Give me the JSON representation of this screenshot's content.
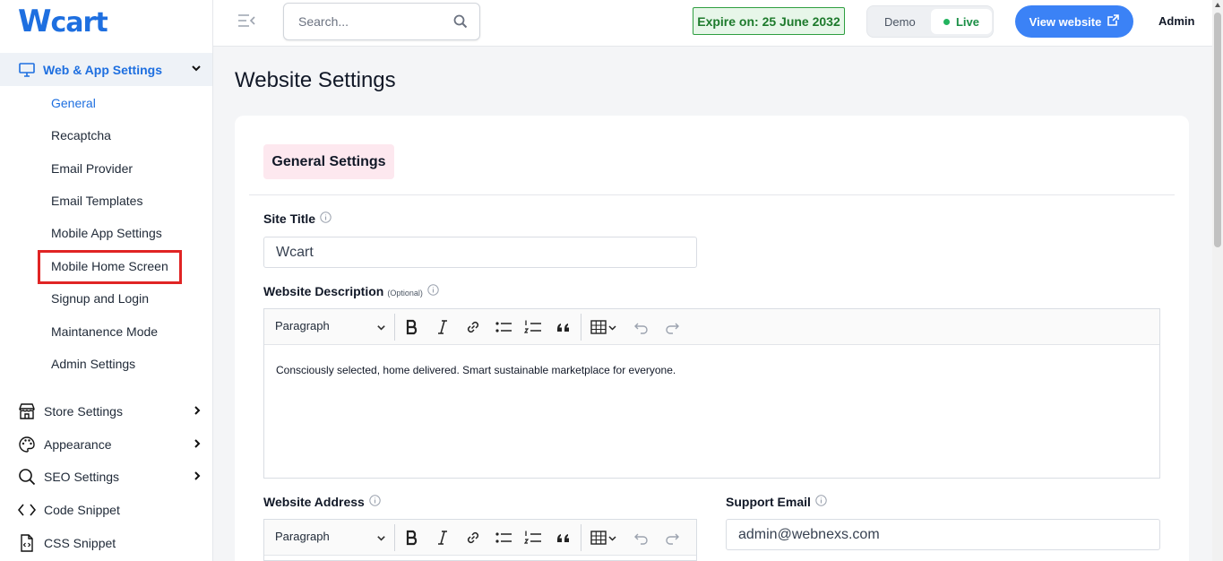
{
  "logo": {
    "text_w": "W",
    "text_rest": "cart"
  },
  "sidebar": {
    "active_section": "Web & App Settings",
    "sub_items": [
      "General",
      "Recaptcha",
      "Email Provider",
      "Email Templates",
      "Mobile App Settings",
      "Mobile Home Screen",
      "Signup and Login",
      "Maintanence Mode",
      "Admin Settings"
    ],
    "items": [
      {
        "label": "Store Settings",
        "icon": "store-icon"
      },
      {
        "label": "Appearance",
        "icon": "palette-icon"
      },
      {
        "label": "SEO Settings",
        "icon": "search-icon"
      },
      {
        "label": "Code Snippet",
        "icon": "code-icon"
      },
      {
        "label": "CSS Snippet",
        "icon": "file-code-icon"
      }
    ]
  },
  "topbar": {
    "search_placeholder": "Search...",
    "expire": "Expire on: 25 June 2032",
    "mode_demo": "Demo",
    "mode_live": "Live",
    "view_website": "View website",
    "admin": "Admin"
  },
  "main": {
    "page_title": "Website Settings",
    "section_title": "General Settings",
    "site_title_label": "Site Title",
    "site_title_value": "Wcart",
    "description_label": "Website Description",
    "optional": "(Optional)",
    "paragraph": "Paragraph",
    "description_value": "Consciously selected, home delivered. Smart sustainable marketplace for everyone.",
    "address_label": "Website Address",
    "support_email_label": "Support Email",
    "support_email_value": "admin@webnexs.com"
  },
  "colors": {
    "accent": "#1e6fe0",
    "button": "#3b82f6",
    "highlight": "#e02424",
    "expire_bg": "#e7f6e9",
    "chip_bg": "#fde8ef"
  }
}
